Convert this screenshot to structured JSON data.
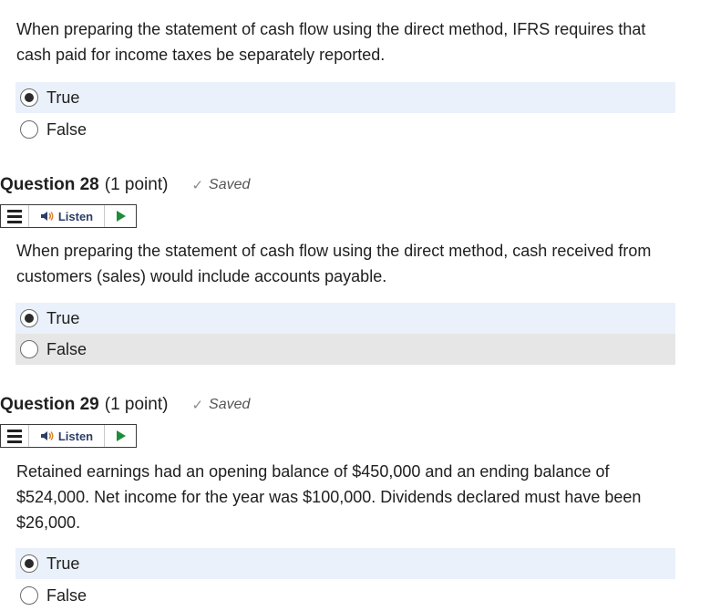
{
  "blocks": [
    {
      "prompt": "When preparing the statement of cash flow using the direct method, IFRS requires that cash paid for income taxes be separately reported.",
      "options": [
        {
          "label": "True",
          "selected": true
        },
        {
          "label": "False",
          "selected": false
        }
      ]
    },
    {
      "title": "Question 28",
      "points": "(1 point)",
      "status": "Saved",
      "listen_label": "Listen",
      "prompt": "When preparing the statement of cash flow using the direct method, cash received from customers (sales) would include accounts payable.",
      "options": [
        {
          "label": "True",
          "selected": true
        },
        {
          "label": "False",
          "selected": false,
          "hovered": true
        }
      ]
    },
    {
      "title": "Question 29",
      "points": "(1 point)",
      "status": "Saved",
      "listen_label": "Listen",
      "prompt": "Retained earnings had an opening balance of $450,000 and an ending balance of $524,000.  Net income for the year was $100,000.  Dividends declared must have been $26,000.",
      "options": [
        {
          "label": "True",
          "selected": true
        },
        {
          "label": "False",
          "selected": false
        }
      ]
    }
  ],
  "colors": {
    "selected_bg": "#eaf1fb",
    "hover_bg": "#e6e6e6",
    "play_green": "#1e8c3a",
    "speaker_blue": "#2c3e66"
  }
}
